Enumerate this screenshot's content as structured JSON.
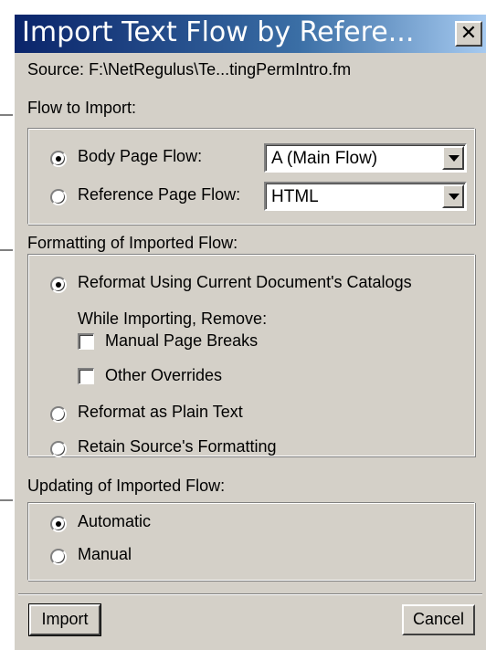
{
  "dialog": {
    "title": "Import Text Flow by Refere...",
    "close_symbol": "✕",
    "source_label": "Source:",
    "source_path": "F:\\NetRegulus\\Te...tingPermIntro.fm"
  },
  "flow_to_import": {
    "heading": "Flow to Import:",
    "body_page_label": "Body Page Flow:",
    "body_page_selected": true,
    "body_page_value": "A (Main Flow)",
    "reference_page_label": "Reference Page Flow:",
    "reference_page_selected": false,
    "reference_page_value": "HTML"
  },
  "formatting": {
    "heading": "Formatting of Imported Flow:",
    "reformat_catalogs_label": "Reformat Using Current Document's Catalogs",
    "reformat_catalogs_selected": true,
    "while_importing_label": "While Importing, Remove:",
    "manual_page_breaks_label": "Manual Page Breaks",
    "manual_page_breaks_checked": false,
    "other_overrides_label": "Other Overrides",
    "other_overrides_checked": false,
    "plain_text_label": "Reformat as Plain Text",
    "retain_source_label": "Retain Source's Formatting"
  },
  "updating": {
    "heading": "Updating of Imported Flow:",
    "automatic_label": "Automatic",
    "automatic_selected": true,
    "manual_label": "Manual"
  },
  "buttons": {
    "import_label": "Import",
    "cancel_label": "Cancel"
  },
  "icons": [
    "close-icon",
    "dropdown-arrow-icon",
    "radio-icon",
    "checkbox-icon"
  ]
}
